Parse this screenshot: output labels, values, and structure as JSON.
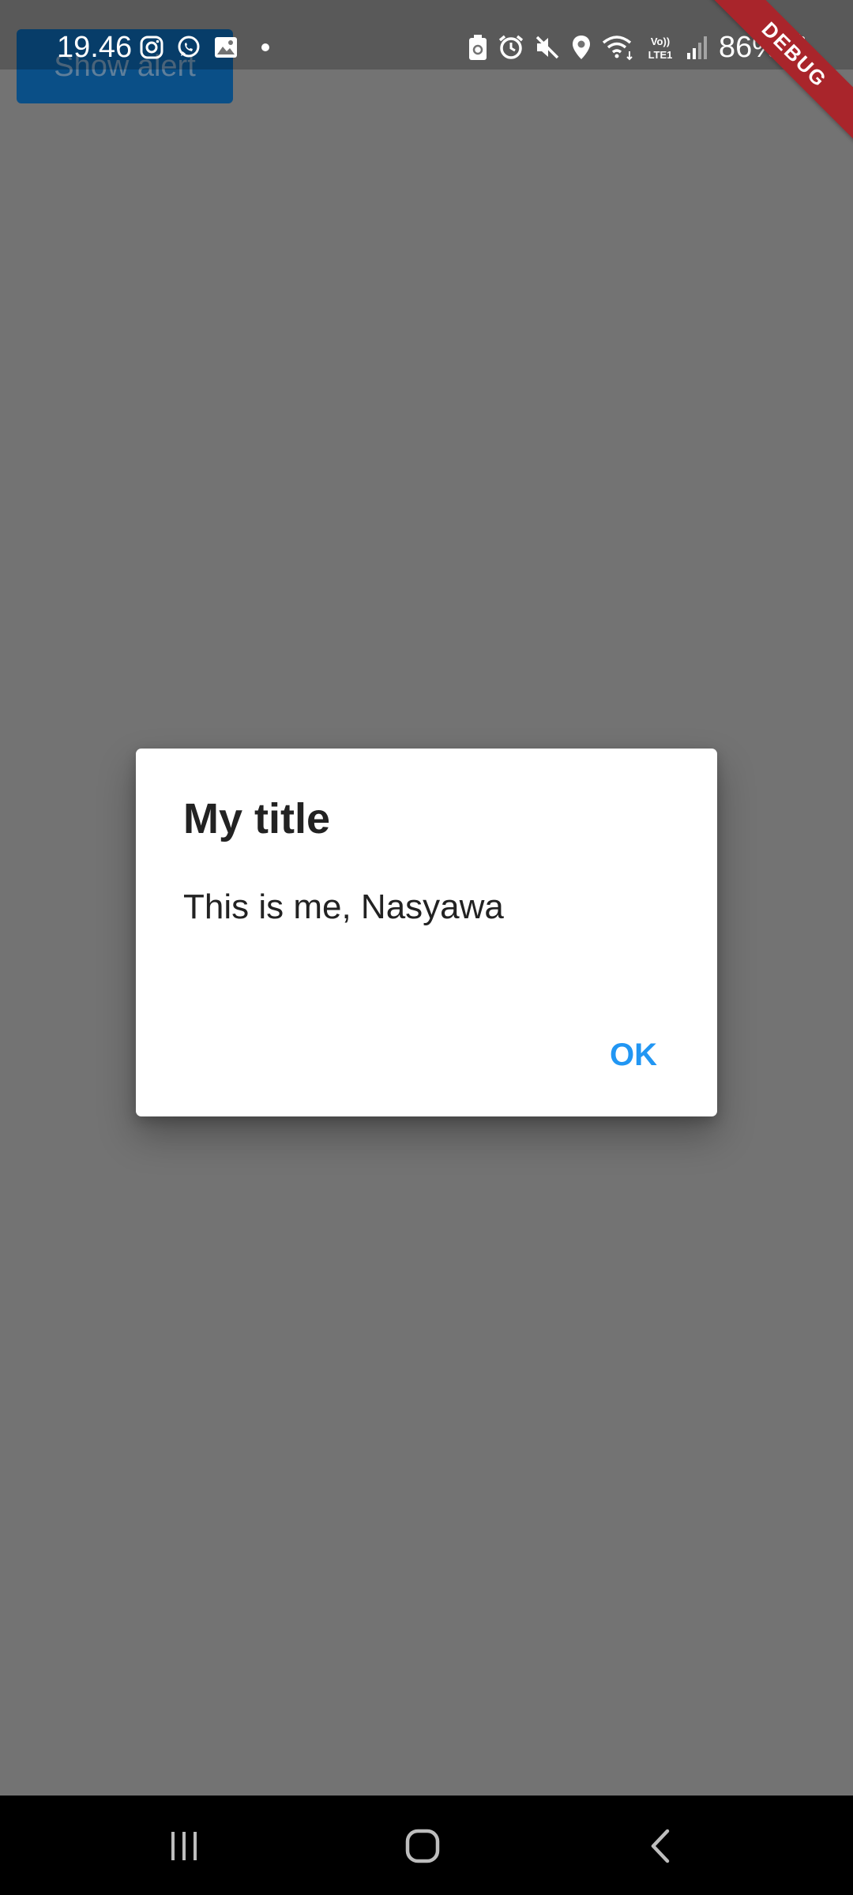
{
  "app": {
    "show_alert_label": "Show alert"
  },
  "status_bar": {
    "time": "19.46",
    "battery": "86%",
    "left_icons": [
      "instagram-icon",
      "whatsapp-icon",
      "gallery-icon",
      "dot-icon"
    ],
    "right_icons": [
      "battery-saver-icon",
      "alarm-icon",
      "mute-icon",
      "location-icon",
      "wifi-icon",
      "volte-icon",
      "signal-icon",
      "charging-icon"
    ],
    "network_text": "Vo)) LTE1"
  },
  "debug_banner": {
    "label": "DEBUG",
    "color": "#a9252b"
  },
  "dialog": {
    "title": "My title",
    "content": "This is me, Nasyawa",
    "ok_label": "OK",
    "accent_color": "#2196f3"
  },
  "navigation": {
    "buttons": [
      "recent-apps-icon",
      "home-icon",
      "back-icon"
    ]
  },
  "colors": {
    "scrim": "#737373",
    "app_button": "#0a4f87"
  }
}
